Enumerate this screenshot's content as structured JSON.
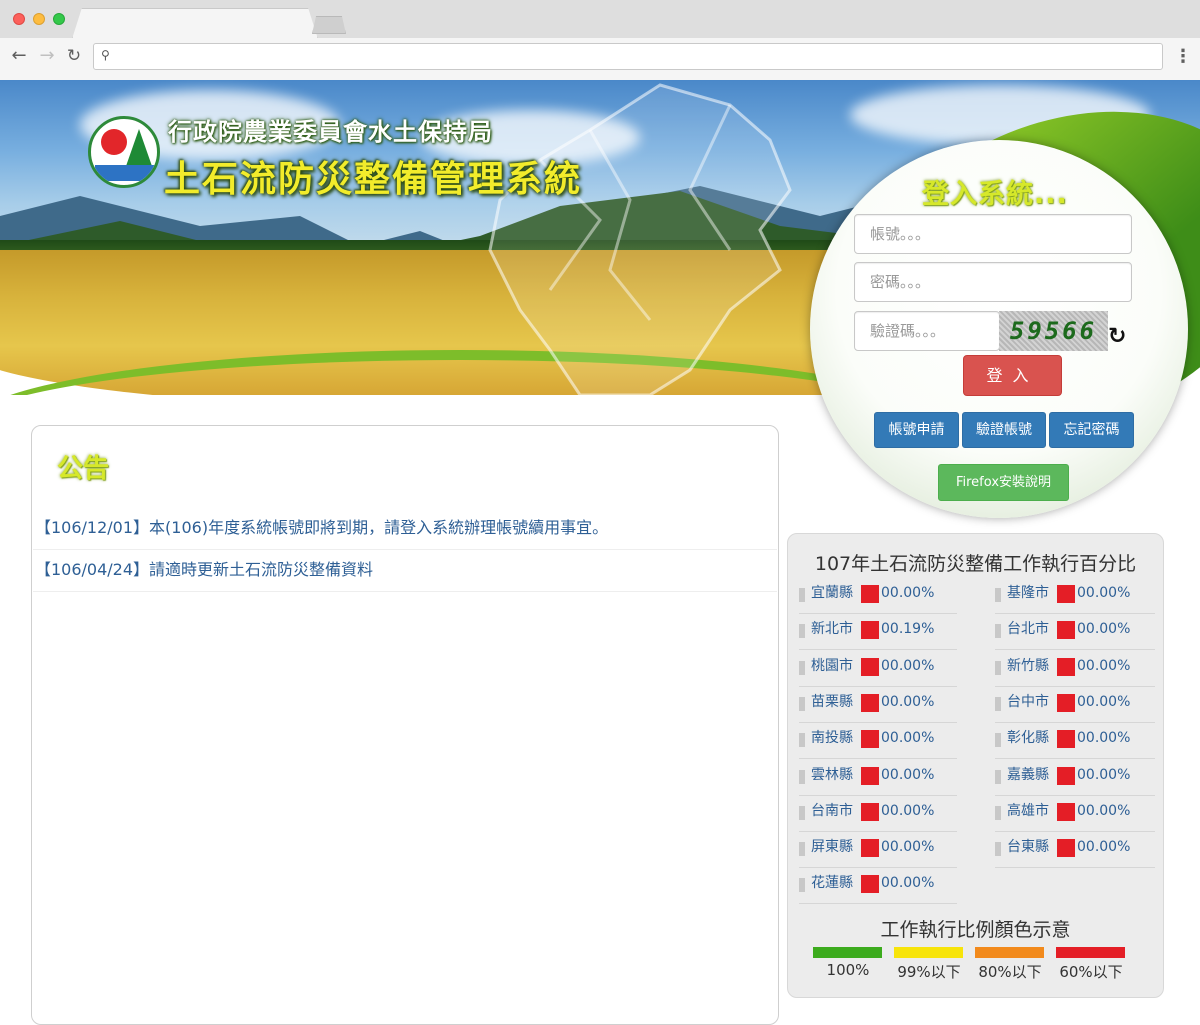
{
  "browser": {
    "url": ""
  },
  "header": {
    "agency": "行政院農業委員會水土保持局",
    "system": "土石流防災整備管理系統"
  },
  "login": {
    "title": "登入系統...",
    "account_placeholder": "帳號。。。",
    "password_placeholder": "密碼。。。",
    "captcha_placeholder": "驗證碼。。。",
    "captcha_code": "59566",
    "submit": "登入",
    "apply": "帳號申請",
    "verify": "驗證帳號",
    "forgot": "忘記密碼",
    "firefox": "Firefox安裝說明"
  },
  "announcements": {
    "title": "公告",
    "items": [
      "【106/12/01】本(106)年度系統帳號即將到期，請登入系統辦理帳號續用事宜。",
      "【106/04/24】請適時更新土石流防災整備資料"
    ]
  },
  "stats": {
    "title": "107年土石流防災整備工作執行百分比",
    "counties": [
      {
        "name": "宜蘭縣",
        "value": "00.00%",
        "color": "#e41e26"
      },
      {
        "name": "基隆市",
        "value": "00.00%",
        "color": "#e41e26"
      },
      {
        "name": "新北市",
        "value": "00.19%",
        "color": "#e41e26"
      },
      {
        "name": "台北市",
        "value": "00.00%",
        "color": "#e41e26"
      },
      {
        "name": "桃園市",
        "value": "00.00%",
        "color": "#e41e26"
      },
      {
        "name": "新竹縣",
        "value": "00.00%",
        "color": "#e41e26"
      },
      {
        "name": "苗栗縣",
        "value": "00.00%",
        "color": "#e41e26"
      },
      {
        "name": "台中市",
        "value": "00.00%",
        "color": "#e41e26"
      },
      {
        "name": "南投縣",
        "value": "00.00%",
        "color": "#e41e26"
      },
      {
        "name": "彰化縣",
        "value": "00.00%",
        "color": "#e41e26"
      },
      {
        "name": "雲林縣",
        "value": "00.00%",
        "color": "#e41e26"
      },
      {
        "name": "嘉義縣",
        "value": "00.00%",
        "color": "#e41e26"
      },
      {
        "name": "台南市",
        "value": "00.00%",
        "color": "#e41e26"
      },
      {
        "name": "高雄市",
        "value": "00.00%",
        "color": "#e41e26"
      },
      {
        "name": "屏東縣",
        "value": "00.00%",
        "color": "#e41e26"
      },
      {
        "name": "台東縣",
        "value": "00.00%",
        "color": "#e41e26"
      },
      {
        "name": "花蓮縣",
        "value": "00.00%",
        "color": "#e41e26"
      }
    ],
    "legend_title": "工作執行比例顏色示意",
    "legend": [
      {
        "label": "100%",
        "color": "#3cab1d"
      },
      {
        "label": "99%以下",
        "color": "#f7e40a"
      },
      {
        "label": "80%以下",
        "color": "#f28a1c"
      },
      {
        "label": "60%以下",
        "color": "#e41e26"
      }
    ]
  }
}
